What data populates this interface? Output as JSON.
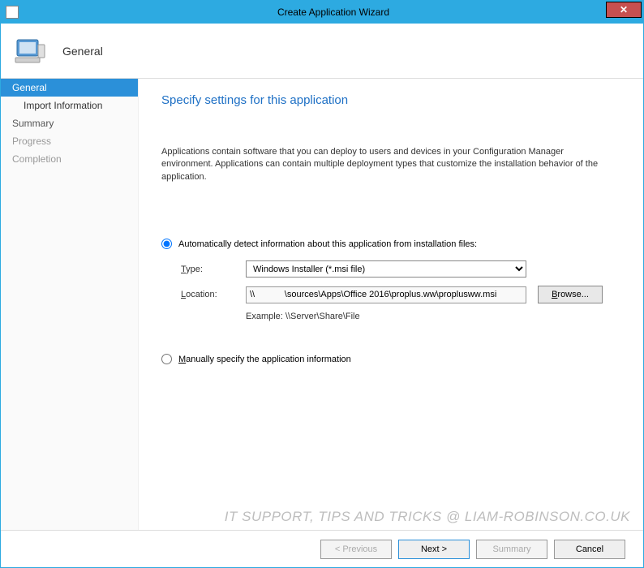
{
  "titlebar": {
    "title": "Create Application Wizard"
  },
  "header": {
    "title": "General"
  },
  "sidebar": {
    "items": [
      {
        "label": "General",
        "active": true
      },
      {
        "label": "Import Information",
        "sub": true
      },
      {
        "label": "Summary"
      },
      {
        "label": "Progress",
        "dim": true
      },
      {
        "label": "Completion",
        "dim": true
      }
    ]
  },
  "main": {
    "title": "Specify settings for this application",
    "description": "Applications contain software that you can deploy to users and devices in your Configuration Manager environment. Applications can contain multiple deployment types that customize the installation behavior of the application.",
    "radio_auto": "Automatically detect information about this application from installation files:",
    "radio_manual": "Manually specify the application information",
    "type_label": "Type:",
    "type_value": "Windows Installer (*.msi file)",
    "location_label": "Location:",
    "location_value": "\\\\            \\sources\\Apps\\Office 2016\\proplus.ww\\proplusww.msi",
    "browse_label": "Browse...",
    "example_text": "Example: \\\\Server\\Share\\File"
  },
  "watermark": "IT SUPPORT, TIPS AND TRICKS @ LIAM-ROBINSON.CO.UK",
  "footer": {
    "previous": "< Previous",
    "next": "Next >",
    "summary": "Summary",
    "cancel": "Cancel"
  }
}
